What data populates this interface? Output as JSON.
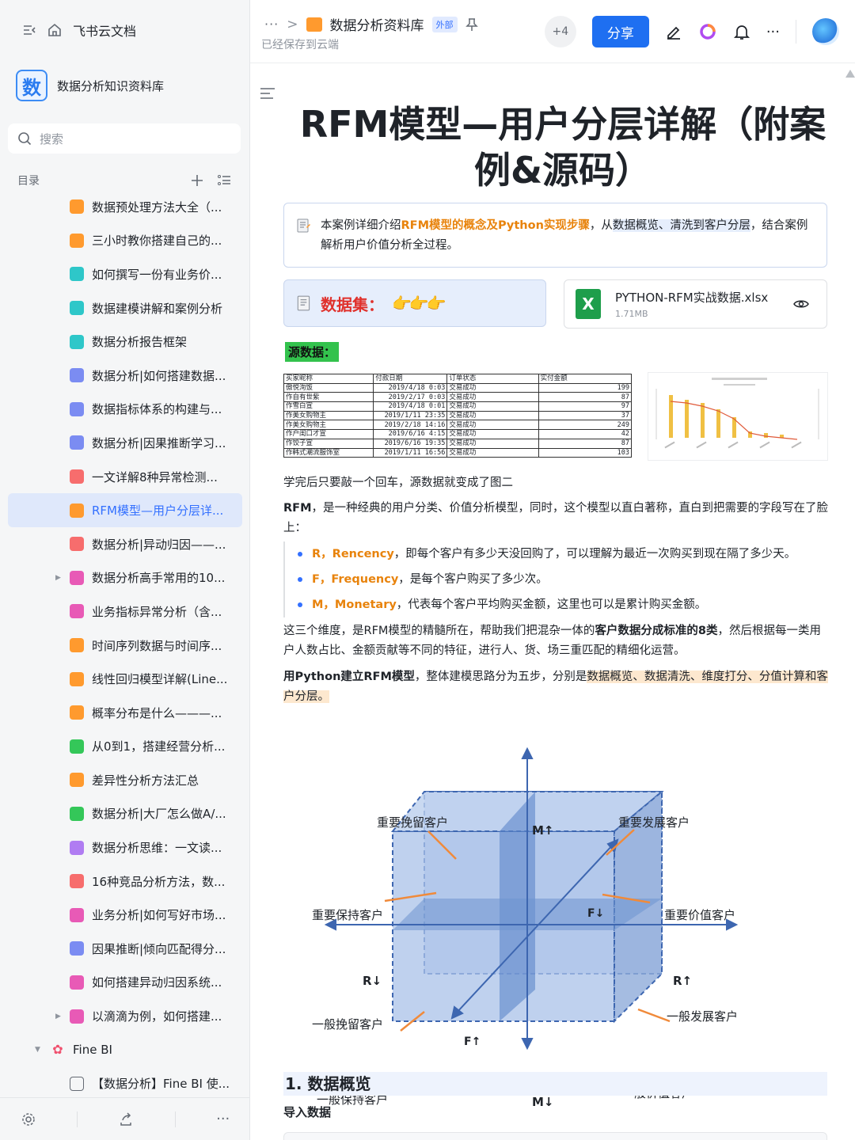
{
  "sidebar": {
    "app_name": "飞书云文档",
    "kb_logo_char": "数",
    "kb_name": "数据分析知识资料库",
    "search_placeholder": "搜索",
    "toc_label": "目录",
    "items": [
      {
        "label": "数据预处理方法大全（...",
        "color": "#ff9a2e"
      },
      {
        "label": "三小时教你搭建自己的...",
        "color": "#ff9a2e"
      },
      {
        "label": "如何撰写一份有业务价...",
        "color": "#2ec7c9"
      },
      {
        "label": "数据建模讲解和案例分析",
        "color": "#2ec7c9"
      },
      {
        "label": "数据分析报告框架",
        "color": "#2ec7c9"
      },
      {
        "label": "数据分析|如何搭建数据...",
        "color": "#7b8cf2"
      },
      {
        "label": "数据指标体系的构建与...",
        "color": "#7b8cf2"
      },
      {
        "label": "数据分析|因果推断学习...",
        "color": "#7b8cf2"
      },
      {
        "label": "一文详解8种异常检测...",
        "color": "#f76d6d"
      },
      {
        "label": "RFM模型—用户分层详...",
        "color": "#ff9a2e",
        "active": true
      },
      {
        "label": "数据分析|异动归因——...",
        "color": "#f76d6d"
      },
      {
        "label": "数据分析高手常用的10...",
        "color": "#e85ab6",
        "caret": "▶"
      },
      {
        "label": "业务指标异常分析（含...",
        "color": "#e85ab6"
      },
      {
        "label": "时间序列数据与时间序...",
        "color": "#ff9a2e"
      },
      {
        "label": "线性回归模型详解(Line...",
        "color": "#ff9a2e"
      },
      {
        "label": "概率分布是什么———...",
        "color": "#ff9a2e"
      },
      {
        "label": "从0到1，搭建经营分析...",
        "color": "#34c759"
      },
      {
        "label": "差异性分析方法汇总",
        "color": "#ff9a2e"
      },
      {
        "label": "数据分析|大厂怎么做A/...",
        "color": "#34c759"
      },
      {
        "label": "数据分析思维：一文读...",
        "color": "#b07cf2"
      },
      {
        "label": "16种竞品分析方法，数...",
        "color": "#f76d6d"
      },
      {
        "label": "业务分析|如何写好市场...",
        "color": "#e85ab6"
      },
      {
        "label": "因果推断|倾向匹配得分...",
        "color": "#7b8cf2"
      },
      {
        "label": "如何搭建异动归因系统...",
        "color": "#e85ab6"
      },
      {
        "label": "以滴滴为例，如何搭建...",
        "color": "#e85ab6",
        "caret": "▶"
      }
    ],
    "group": {
      "label": "Fine BI",
      "caret": "▼"
    },
    "group_child": {
      "label": "【数据分析】Fine BI 使..."
    }
  },
  "header": {
    "breadcrumb_more": "···",
    "crumb_sep": ">",
    "folder_title": "数据分析资料库",
    "external_tag": "外部",
    "saved_text": "已经保存到云端",
    "collab_count": "+4",
    "share_label": "分享",
    "more_label": "···"
  },
  "doc": {
    "title": "RFM模型—用户分层详解（附案例&源码）",
    "callout": {
      "t1": "本案例详细介绍",
      "t2": "RFM模型的概念及Python实现步骤",
      "t3": "，从",
      "t4": "数据概览、清洗到客户分层",
      "t5": "，结合案例解析用户价值分析全过程。"
    },
    "dataset_label": "数据集：",
    "file": {
      "name": "PYTHON-RFM实战数据.xlsx",
      "size": "1.71MB",
      "ext": "X"
    },
    "source_label": "源数据：",
    "table_header": [
      "买家昵称",
      "付款日期",
      "订单状态",
      "实付金额"
    ],
    "table_rows": [
      [
        "傲悦洵饭",
        "2019/4/18  0:03",
        "交易成功",
        "199"
      ],
      [
        "作自有世紫",
        "2019/2/17  0:03",
        "交易成功",
        "87"
      ],
      [
        "作雪白宣",
        "2019/4/18  0:01",
        "交易成功",
        "97"
      ],
      [
        "作美女购物主",
        "2019/1/11  23:35",
        "交易成功",
        "37"
      ],
      [
        "作美女购物主",
        "2019/2/18  14:16",
        "交易成功",
        "249"
      ],
      [
        "作户闺口才宣",
        "2019/6/16  4:15",
        "交易成功",
        "42"
      ],
      [
        "作饺子宣",
        "2019/6/16  19:35",
        "交易成功",
        "87"
      ],
      [
        "作韩式潮流服饰室",
        "2019/1/11  16:56",
        "交易成功",
        "103"
      ]
    ],
    "para1": "学完后只要敲一个回车，源数据就变成了图二",
    "para2_bold": "RFM",
    "para2": "，是一种经典的用户分类、价值分析模型，同时，这个模型以直白著称，直白到把需要的字段写在了脸上：",
    "bullets": [
      {
        "key": "R，Rencency",
        "text": "，即每个客户有多少天没回购了，可以理解为最近一次购买到现在隔了多少天。"
      },
      {
        "key": "F，Frequency",
        "text": "，是每个客户购买了多少次。"
      },
      {
        "key": "M，Monetary",
        "text": "，代表每个客户平均购买金额，这里也可以是累计购买金额。"
      }
    ],
    "para3a": "这三个维度，是RFM模型的精髓所在，帮助我们把混杂一体的",
    "para3b": "客户数据分成标准的8类",
    "para3c": "，然后根据每一类用户人数占比、金额贡献等不同的特征，进行人、货、场三重匹配的精细化运营。",
    "para4a": "用Python建立RFM模型",
    "para4b": "，整体建模思路分为五步，分别是",
    "para4c": "数据概览、数据清洗、维度打分、分值计算和客户分层。",
    "cube": {
      "labels": {
        "tl": "重要挽留客户",
        "tr": "重要发展客户",
        "ml": "重要保持客户",
        "mr": "重要价值客户",
        "bl1": "一般挽留客户",
        "br1": "一般发展客户",
        "bl2": "一般保持客户",
        "br2": "一般价值客户",
        "m_up": "M↑",
        "m_down": "M↓",
        "r_down": "R↓",
        "r_up": "R↑",
        "f_down": "F↓",
        "f_up": "F↑"
      }
    },
    "h1": "1. 数据概览",
    "h2": "导入数据"
  }
}
